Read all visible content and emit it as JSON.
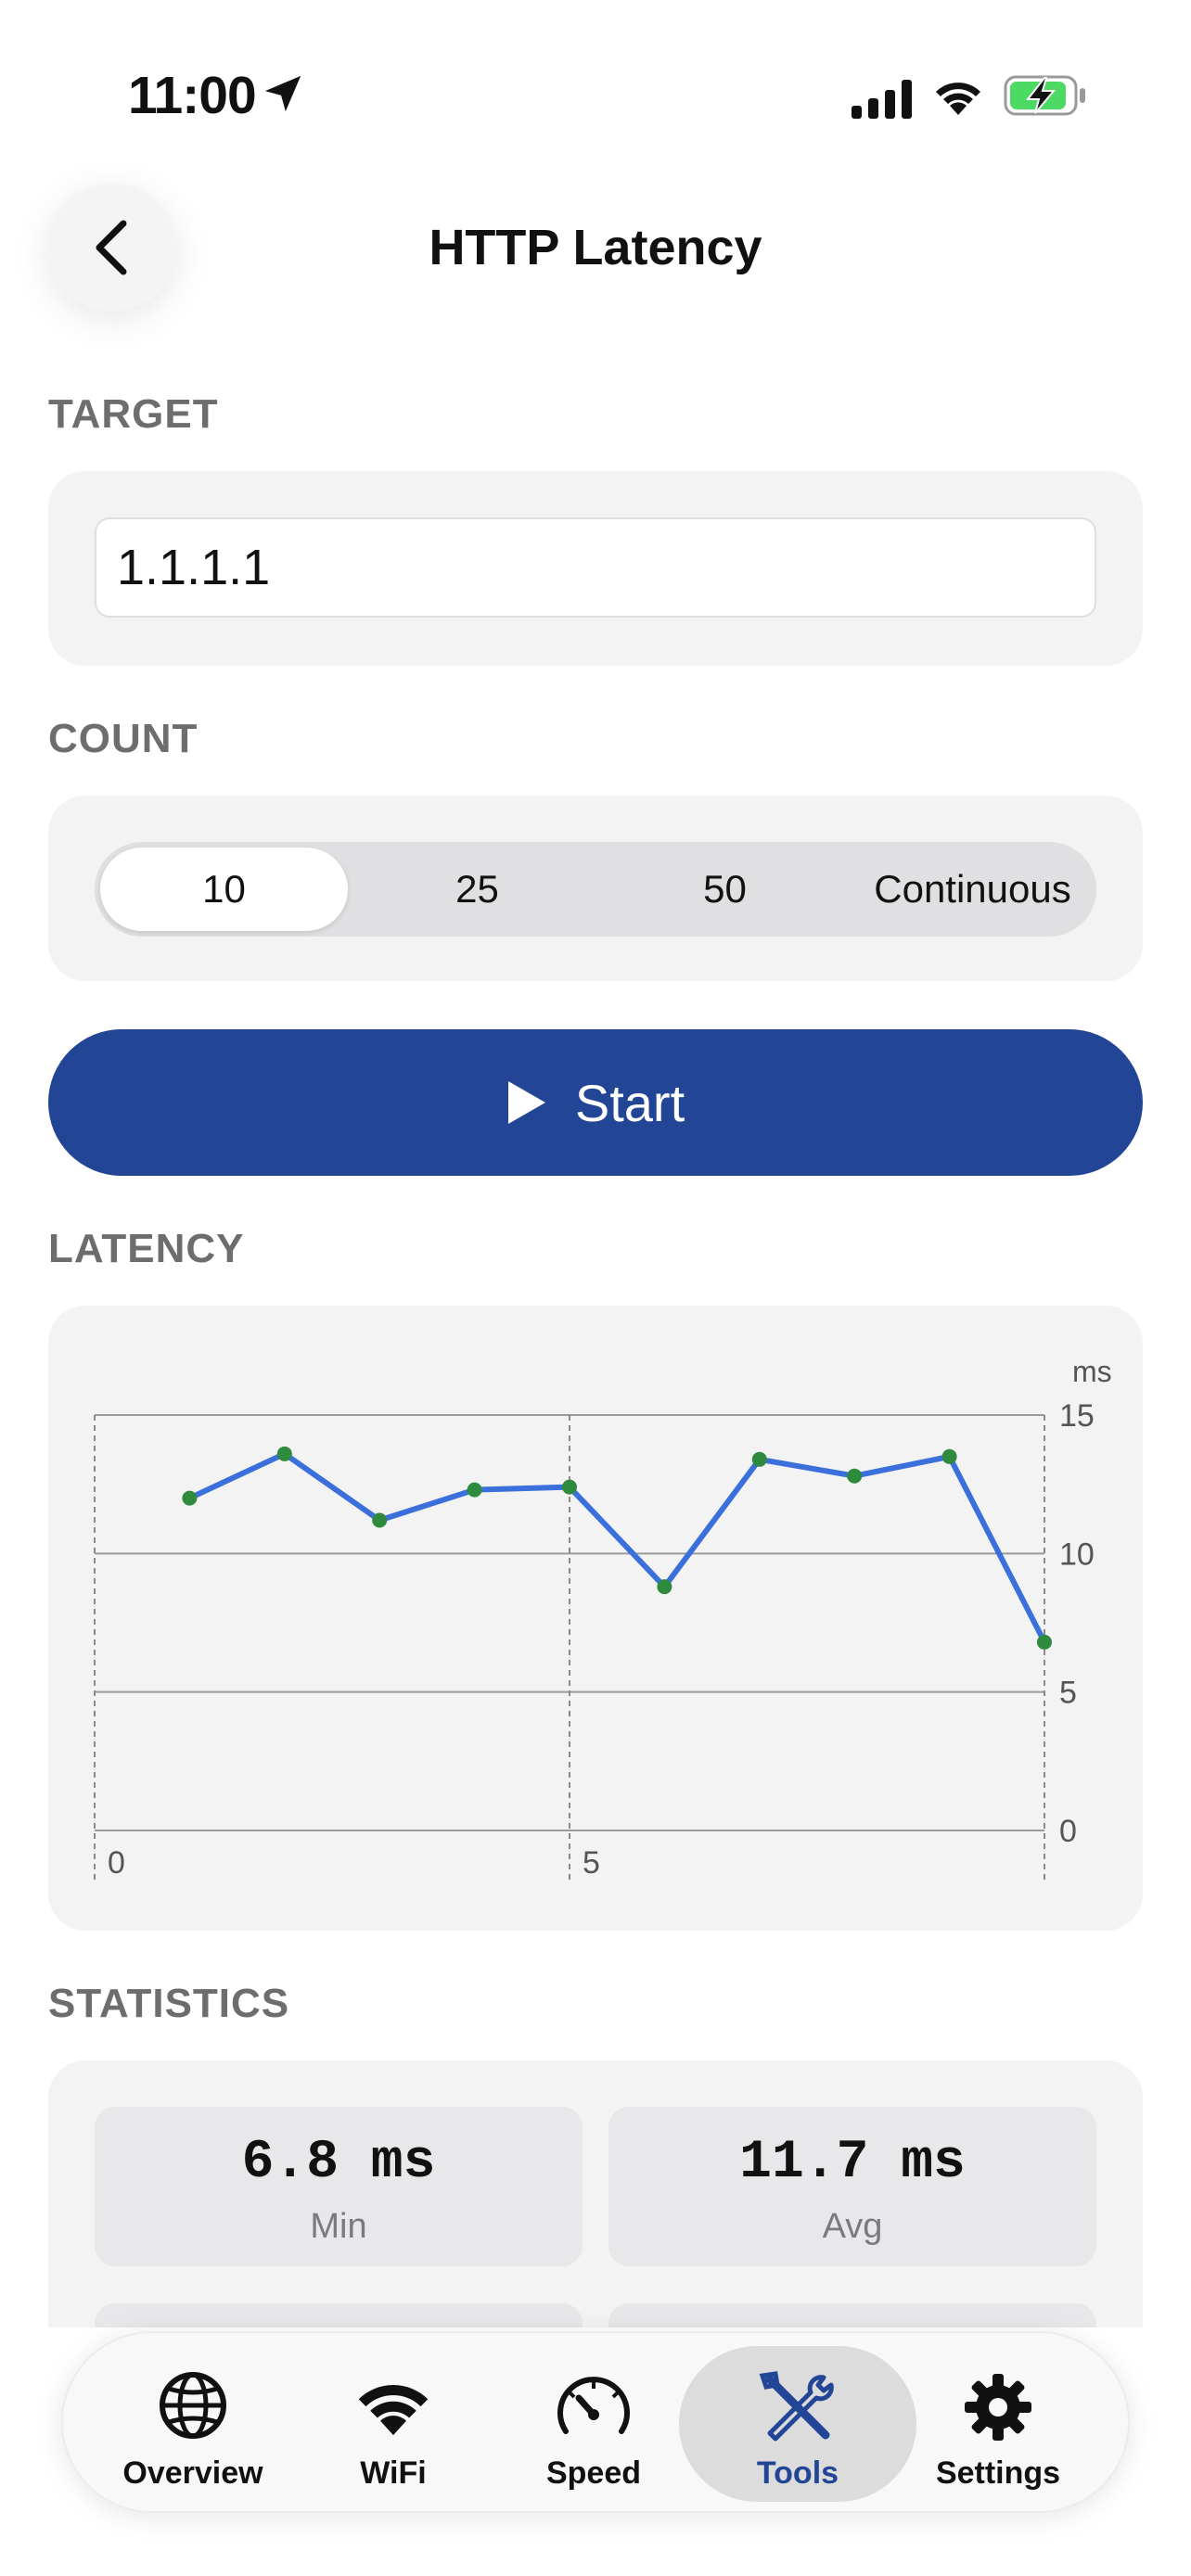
{
  "status_bar": {
    "time": "11:00"
  },
  "header": {
    "title": "HTTP Latency"
  },
  "target": {
    "label": "TARGET",
    "value": "1.1.1.1"
  },
  "count": {
    "label": "COUNT",
    "options": [
      "10",
      "25",
      "50",
      "Continuous"
    ],
    "selected": "10"
  },
  "start_button": {
    "label": "Start"
  },
  "latency": {
    "label": "LATENCY"
  },
  "chart_data": {
    "type": "line",
    "unit_label": "ms",
    "x": [
      1,
      2,
      3,
      4,
      5,
      6,
      7,
      8,
      9,
      10
    ],
    "values": [
      12.0,
      13.6,
      11.2,
      12.3,
      12.4,
      8.8,
      13.4,
      12.8,
      13.5,
      6.8
    ],
    "xlim": [
      0,
      10
    ],
    "ylim": [
      0,
      15
    ],
    "y_ticks": [
      0,
      5,
      10,
      15
    ],
    "x_tick_labels": [
      "0",
      "5"
    ],
    "line_color": "#3a6fdc",
    "point_color": "#2e8a3c",
    "grid": true
  },
  "statistics": {
    "label": "STATISTICS",
    "items": [
      {
        "value": "6.8 ms",
        "label": "Min"
      },
      {
        "value": "11.7 ms",
        "label": "Avg"
      }
    ]
  },
  "tab_bar": {
    "tabs": [
      {
        "label": "Overview",
        "icon": "globe-icon"
      },
      {
        "label": "WiFi",
        "icon": "wifi-icon"
      },
      {
        "label": "Speed",
        "icon": "speedometer-icon"
      },
      {
        "label": "Tools",
        "icon": "tools-icon",
        "active": true
      },
      {
        "label": "Settings",
        "icon": "gear-icon"
      }
    ]
  },
  "colors": {
    "accent": "#224596",
    "card": "#f3f3f3"
  }
}
